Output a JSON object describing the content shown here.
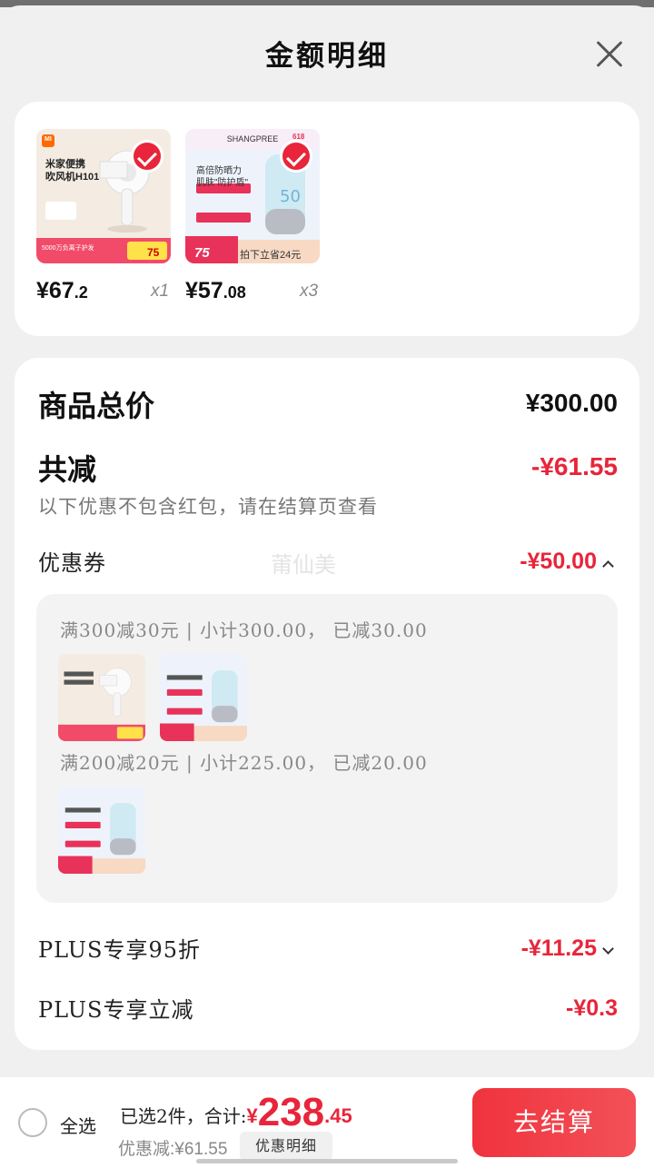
{
  "header": {
    "title": "金额明细"
  },
  "products": [
    {
      "price_int": "¥67",
      "price_dec": ".2",
      "qty": "x1",
      "image": "hair-dryer-product",
      "img_lines": [
        "米家便携",
        "吹风机H101",
        "5000万负离子护发"
      ],
      "img_badge": "75",
      "img_brand": "MI"
    },
    {
      "price_int": "¥57",
      "price_dec": ".08",
      "qty": "x3",
      "image": "sunscreen-product",
      "img_lines": [
        "SHANGPREE",
        "高倍防晒力",
        "肌肤\"防护盾\"",
        "拍下立省24元"
      ],
      "img_badge": "75",
      "img_tag": "618"
    }
  ],
  "detail": {
    "total_label": "商品总价",
    "total_value": "¥300.00",
    "reduce_label": "共减",
    "reduce_value": "-¥61.55",
    "note": "以下优惠不包含红包，请在结算页查看",
    "coupon_label": "优惠券",
    "coupon_value": "-¥50.00",
    "watermark": "莆仙美",
    "coupons": [
      {
        "text": "满300减30元 | 小计300.00， 已减30.00",
        "thumbs": [
          "hair-dryer-product",
          "sunscreen-product"
        ]
      },
      {
        "text": "满200减20元 | 小计225.00， 已减20.00",
        "thumbs": [
          "sunscreen-product"
        ]
      }
    ],
    "plus_discount_label": "PLUS专享95折",
    "plus_discount_value": "-¥11.25",
    "plus_reduce_label": "PLUS专享立减",
    "plus_reduce_value": "-¥0.3"
  },
  "bottom": {
    "select_all": "全选",
    "selected_text": "已选2件，合计:",
    "total_symbol": "¥",
    "total_int": "238",
    "total_dec": ".45",
    "saved_text": "优惠减:¥61.55",
    "detail_link": "优惠明细",
    "checkout": "去结算"
  },
  "colors": {
    "accent": "#e8253a",
    "checkout_bg": "#f0333d"
  }
}
